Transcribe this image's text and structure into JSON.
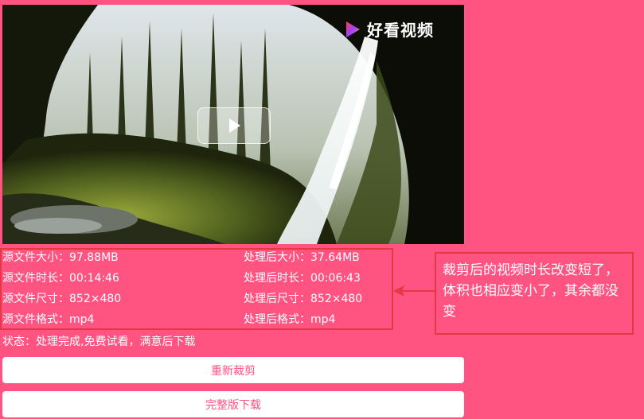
{
  "video": {
    "brand": "好看视频",
    "play_icon": "play-icon"
  },
  "info": {
    "left": [
      "源文件大小：97.88MB",
      "源文件时长：00:14:46",
      "源文件尺寸：852×480",
      "源文件格式：mp4"
    ],
    "right": [
      "处理后大小：37.64MB",
      "处理后时长：00:06:43",
      "处理后尺寸：852×480",
      "处理后格式：mp4"
    ]
  },
  "status": "状态：处理完成,免费试看，满意后下载",
  "buttons": {
    "recrop": "重新裁剪",
    "download": "完整版下载"
  },
  "annotation": {
    "text": "裁剪后的视频时长改变短了，体积也相应变小了，其余都没变"
  },
  "colors": {
    "background": "#ff5382",
    "accent_red": "#e53844",
    "button_text": "#ff5382"
  }
}
